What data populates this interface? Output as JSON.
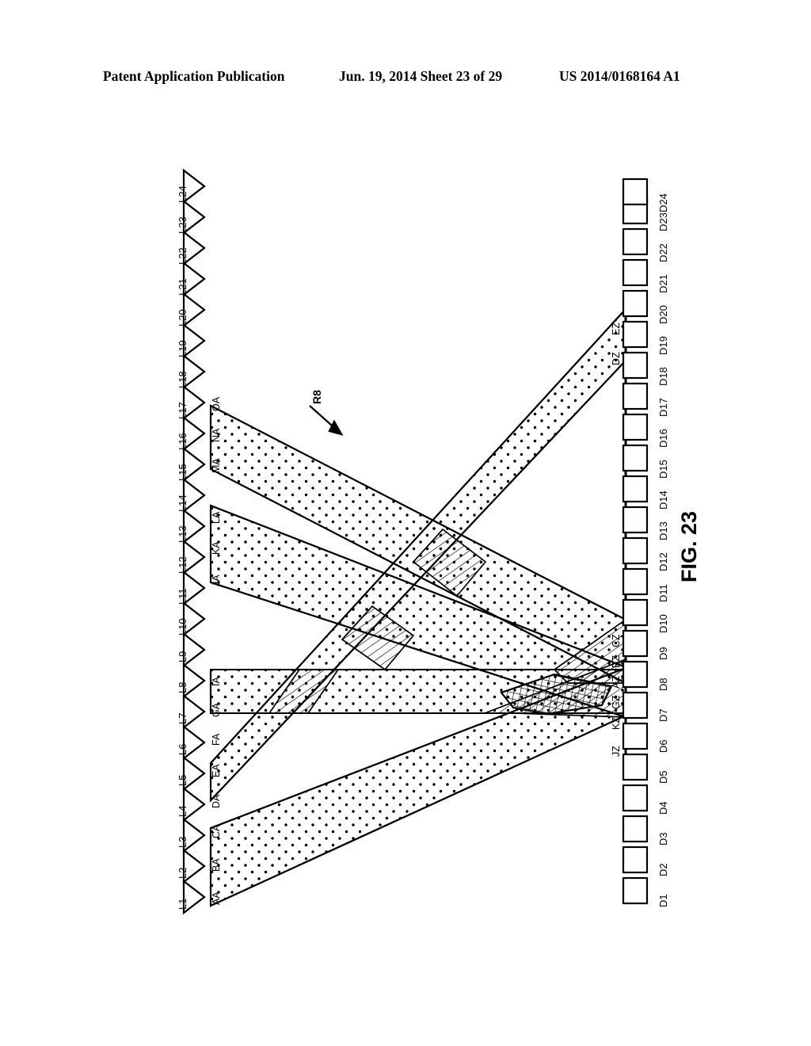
{
  "header": {
    "publication": "Patent Application Publication",
    "date_sheet": "Jun. 19, 2014  Sheet 23 of 29",
    "doc_number": "US 2014/0168164 A1"
  },
  "figure": {
    "caption": "FIG. 23",
    "reference_label": "R8",
    "reference_icon": "arrow-down-right-icon"
  },
  "left_axis": {
    "marker_icon": "triangle-right-icon",
    "labels": [
      "L1",
      "L2",
      "L3",
      "L4",
      "L5",
      "L6",
      "L7",
      "L8",
      "L9",
      "L10",
      "L11",
      "L12",
      "L13",
      "L14",
      "L15",
      "L16",
      "L17",
      "L18",
      "L19",
      "L20",
      "L21",
      "L22",
      "L23",
      "L24"
    ]
  },
  "right_axis": {
    "marker_icon": "rectangle-icon",
    "labels": [
      "D1",
      "D2",
      "D3",
      "D4",
      "D5",
      "D6",
      "D7",
      "D8",
      "D9",
      "D10",
      "D11",
      "D12",
      "D13",
      "D14",
      "D15",
      "D16",
      "D17",
      "D18",
      "D19",
      "D20",
      "D21",
      "D22",
      "D23",
      "D24"
    ]
  },
  "source_labels": [
    "AA",
    "BA",
    "CA",
    "DA",
    "EA",
    "FA",
    "GA",
    "IA",
    "JA",
    "KA",
    "LA",
    "MA",
    "NA",
    "OA"
  ],
  "destination_labels": [
    "JZ",
    "KZ",
    "GZ",
    "AZ",
    "BZ",
    "CZ",
    "DZ",
    "EZ"
  ],
  "chart_data": {
    "type": "diagram",
    "title": "FIG. 23",
    "description": "Beam-path routing diagram: stippled diagonal bands propagate from left-side source taps (triangles L1-L24) to right-side destination ports (rectangles D1-D24). Hatched regions mark two-band overlaps; the cross-hatched lens marks a three-band overlap.",
    "bands": [
      {
        "name": "band-AA-CA",
        "start_labels": [
          "AA",
          "BA",
          "CA"
        ],
        "end_labels": [
          "AZ",
          "BZ"
        ],
        "fill": "stipple",
        "direction": "up-right"
      },
      {
        "name": "band-DA-FA",
        "start_labels": [
          "DA",
          "EA",
          "FA"
        ],
        "end_labels": [
          "DZ",
          "EZ"
        ],
        "fill": "stipple",
        "direction": "up-right-steep"
      },
      {
        "name": "band-GA-IA",
        "start_labels": [
          "GA",
          "IA"
        ],
        "end_labels": [
          "GZ",
          "AZ"
        ],
        "fill": "stipple",
        "direction": "horizontal"
      },
      {
        "name": "band-JA-LA",
        "start_labels": [
          "JA",
          "KA",
          "LA"
        ],
        "end_labels": [
          "JZ",
          "KZ"
        ],
        "fill": "stipple",
        "direction": "down-right"
      },
      {
        "name": "band-MA-OA",
        "start_labels": [
          "MA",
          "NA",
          "OA"
        ],
        "end_labels": [
          "BZ",
          "CZ"
        ],
        "fill": "stipple",
        "direction": "down-right"
      }
    ],
    "overlap_regions": [
      {
        "name": "overlap-upper",
        "fill": "hatch"
      },
      {
        "name": "overlap-middle",
        "fill": "hatch"
      },
      {
        "name": "overlap-lower",
        "fill": "hatch"
      },
      {
        "name": "overlap-triple",
        "fill": "crosshatch"
      }
    ],
    "colors": {
      "ink": "#000000",
      "paper": "#ffffff"
    }
  }
}
